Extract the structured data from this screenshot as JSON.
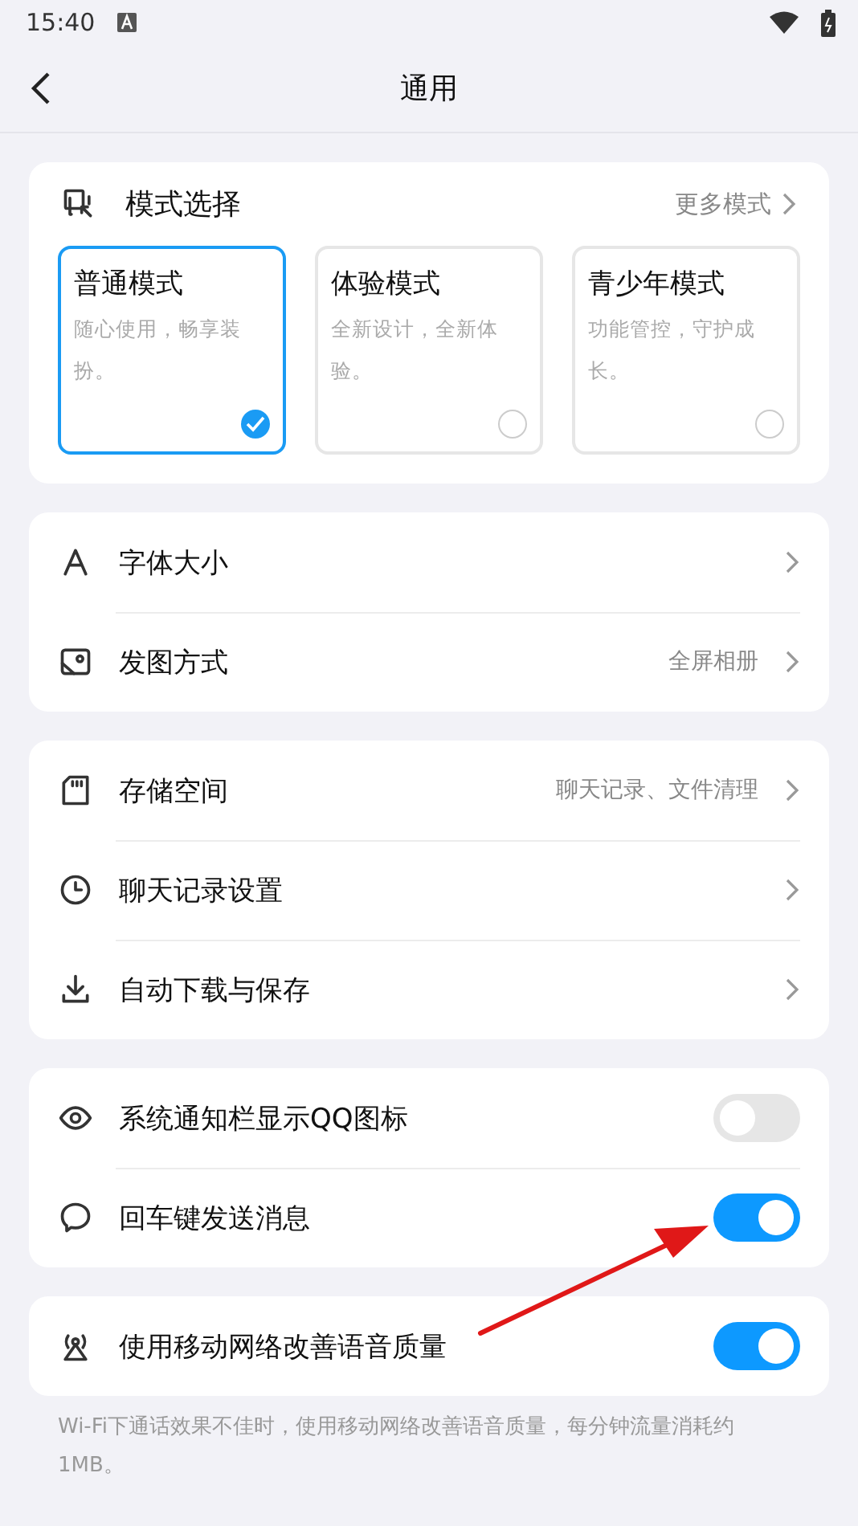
{
  "status_bar": {
    "time": "15:40"
  },
  "header": {
    "title": "通用"
  },
  "mode_card": {
    "title": "模式选择",
    "more": "更多模式",
    "modes": [
      {
        "name": "普通模式",
        "description": "随心使用，畅享装扮。",
        "selected": true
      },
      {
        "name": "体验模式",
        "description": "全新设计，全新体验。",
        "selected": false
      },
      {
        "name": "青少年模式",
        "description": "功能管控，守护成长。",
        "selected": false
      }
    ]
  },
  "groups": [
    {
      "items": [
        {
          "kind": "link",
          "label": "字体大小"
        },
        {
          "kind": "link",
          "label": "发图方式",
          "value": "全屏相册"
        }
      ]
    },
    {
      "items": [
        {
          "kind": "link",
          "label": "存储空间",
          "value": "聊天记录、文件清理"
        },
        {
          "kind": "link",
          "label": "聊天记录设置"
        },
        {
          "kind": "link",
          "label": "自动下载与保存"
        }
      ]
    },
    {
      "items": [
        {
          "kind": "toggle",
          "label": "系统通知栏显示QQ图标",
          "on": false
        },
        {
          "kind": "toggle",
          "label": "回车键发送消息",
          "on": true
        }
      ]
    },
    {
      "items": [
        {
          "kind": "toggle",
          "label": "使用移动网络改善语音质量",
          "on": true
        }
      ],
      "note": "Wi-Fi下通话效果不佳时，使用移动网络改善语音质量，每分钟流量消耗约1MB。"
    }
  ]
}
